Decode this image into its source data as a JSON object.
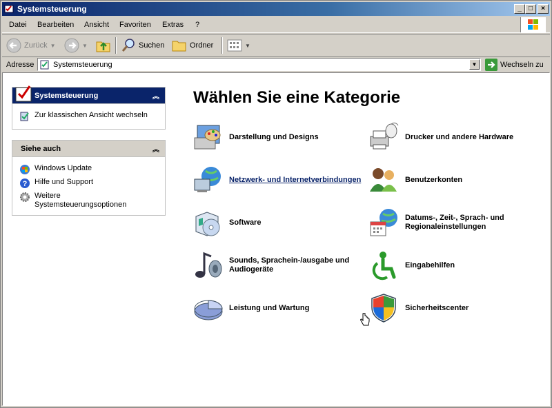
{
  "window": {
    "title": "Systemsteuerung"
  },
  "menu": [
    "Datei",
    "Bearbeiten",
    "Ansicht",
    "Favoriten",
    "Extras",
    "?"
  ],
  "toolbar": {
    "back": "Zurück",
    "search": "Suchen",
    "folders": "Ordner"
  },
  "address": {
    "label": "Adresse",
    "value": "Systemsteuerung",
    "go": "Wechseln zu"
  },
  "sidebar": {
    "panel1": {
      "title": "Systemsteuerung",
      "link": "Zur klassischen Ansicht wechseln"
    },
    "panel2": {
      "title": "Siehe auch",
      "links": [
        "Windows Update",
        "Hilfe und Support",
        "Weitere Systemsteuerungsoptionen"
      ]
    }
  },
  "main": {
    "heading": "Wählen Sie eine Kategorie",
    "categories": [
      "Darstellung und Designs",
      "Netzwerk- und Internetverbindungen",
      "Software",
      "Sounds, Sprachein-/ausgabe und Audiogeräte",
      "Leistung und Wartung",
      "Drucker und andere Hardware",
      "Benutzerkonten",
      "Datums-, Zeit-, Sprach- und Regionaleinstellungen",
      "Eingabehilfen",
      "Sicherheitscenter"
    ]
  },
  "colors": {
    "titlebar": "#0a246a",
    "link": "#0a246a",
    "panel_head": "#d4d0c8"
  }
}
